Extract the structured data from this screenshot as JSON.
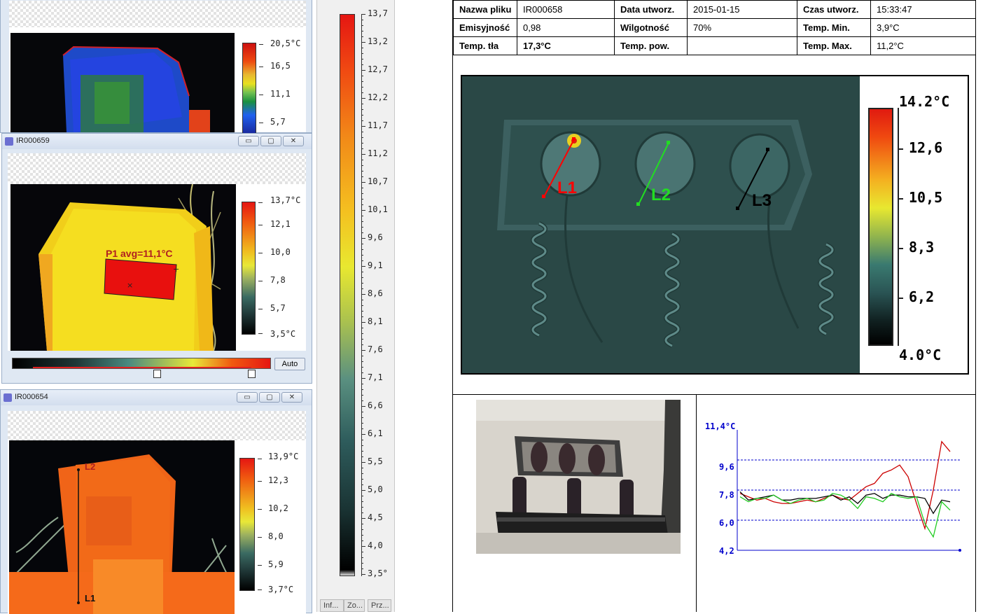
{
  "windows": [
    {
      "title": "",
      "scale_labels": [
        "20,5°C",
        "16,5",
        "11,1",
        "5,7"
      ]
    },
    {
      "title": "IR000659",
      "scale_labels": [
        "13,7°C",
        "12,1",
        "10,0",
        "7,8",
        "5,7",
        "3,5°C"
      ],
      "annotation": "P1 avg=11,1°C",
      "auto_button": "Auto"
    },
    {
      "title": "IR000654",
      "scale_labels": [
        "13,9°C",
        "12,3",
        "10,2",
        "8,0",
        "5,9",
        "3,7°C"
      ],
      "line_labels": [
        "L2",
        "L1"
      ]
    }
  ],
  "big_scale": {
    "labels": [
      "13,7",
      "13,2",
      "12,7",
      "12,2",
      "11,7",
      "11,2",
      "10,7",
      "10,1",
      "9,6",
      "9,1",
      "8,6",
      "8,1",
      "7,6",
      "7,1",
      "6,6",
      "6,1",
      "5,5",
      "5,0",
      "4,5",
      "4,0",
      "3,5°"
    ],
    "tabs": [
      "Inf...",
      "Zo...",
      "Prz..."
    ]
  },
  "report": {
    "rows": [
      [
        [
          "Nazwa pliku",
          "IR000658"
        ],
        [
          "Data utworz.",
          "2015-01-15"
        ],
        [
          "Czas utworz.",
          "15:33:47"
        ]
      ],
      [
        [
          "Emisyjność",
          "0,98"
        ],
        [
          "Wilgotność",
          "70%"
        ],
        [
          "Temp. Min.",
          "3,9°C"
        ]
      ],
      [
        [
          "Temp. tła",
          "17,3°C"
        ],
        [
          "Temp. pow.",
          ""
        ],
        [
          "Temp. Max.",
          "11,2°C"
        ]
      ]
    ],
    "main_scale": [
      "14.2°C",
      "12,6",
      "10,5",
      "8,3",
      "6,2",
      "4.0°C"
    ],
    "main_lines": [
      "L1",
      "L2",
      "L3"
    ],
    "colors": {
      "L1": "#ff0000",
      "L2": "#22dd22",
      "L3": "#000000"
    }
  },
  "chart_data": {
    "type": "line",
    "y_ticks": [
      "11,4°C",
      "9,6",
      "7,8",
      "6,0",
      "4,2"
    ],
    "ylim": [
      4.2,
      11.4
    ],
    "grid": "dashed at 9,6 / 7,8 / 6,0",
    "series": [
      {
        "color": "#cc0000",
        "values": [
          7.6,
          7.4,
          7.2,
          7.3,
          7.1,
          7.0,
          7.0,
          7.1,
          7.2,
          7.1,
          7.3,
          7.5,
          7.3,
          7.2,
          7.6,
          8.0,
          8.2,
          8.8,
          9.0,
          9.3,
          8.6,
          7.0,
          5.5,
          7.8,
          10.7,
          10.1
        ]
      },
      {
        "color": "#000000",
        "values": [
          7.7,
          7.2,
          7.3,
          7.4,
          7.5,
          7.2,
          7.2,
          7.3,
          7.3,
          7.3,
          7.4,
          7.5,
          7.2,
          7.4,
          7.0,
          7.5,
          7.6,
          7.3,
          7.5,
          7.5,
          7.4,
          7.4,
          7.3,
          6.4,
          7.2,
          7.1
        ]
      },
      {
        "color": "#22cc22",
        "values": [
          7.4,
          7.1,
          7.3,
          7.3,
          7.5,
          7.2,
          7.0,
          7.2,
          7.3,
          7.1,
          7.2,
          7.6,
          7.5,
          7.2,
          6.7,
          7.4,
          7.3,
          7.1,
          7.6,
          7.4,
          7.3,
          7.4,
          5.8,
          5.0,
          7.1,
          6.6
        ]
      }
    ]
  }
}
